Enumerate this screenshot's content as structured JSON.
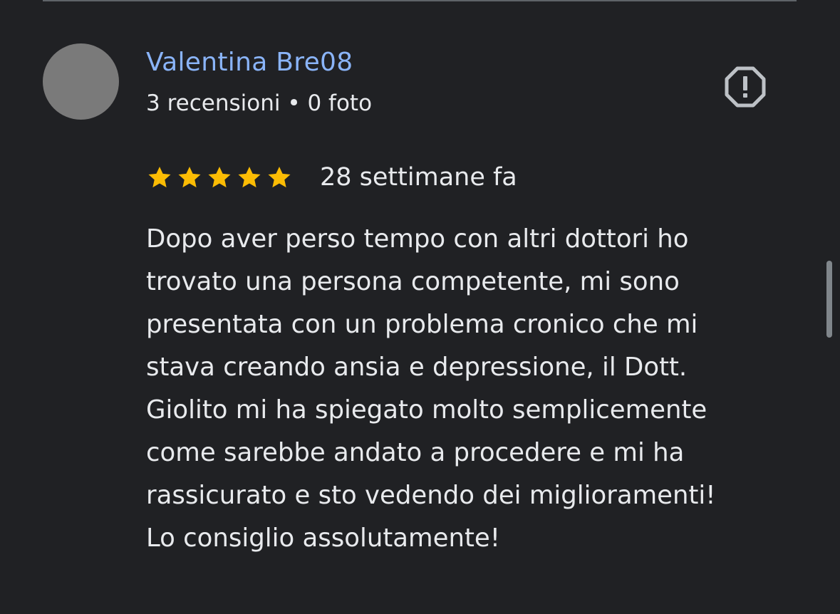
{
  "review": {
    "author_name": "Valentina Bre08",
    "author_meta": "3 recensioni • 0 foto",
    "rating": 5,
    "rating_max": 5,
    "date": "28 settimane fa",
    "text": "Dopo aver perso tempo con altri dottori ho\ntrovato una persona competente, mi sono\npresentata con un problema cronico che mi\nstava creando ansia e depressione, il Dott.\nGiolito mi ha spiegato molto semplicemente\ncome sarebbe andato a procedere e mi ha\nrassicurato e sto vedendo dei miglioramenti!\nLo consiglio assolutamente!"
  },
  "icons": {
    "report": "report-octagon-icon",
    "star": "star-icon"
  },
  "colors": {
    "background": "#202124",
    "author_name": "#8ab4f8",
    "star": "#fbbc04",
    "text": "#e8eaed",
    "avatar": "#7a7a7a"
  }
}
